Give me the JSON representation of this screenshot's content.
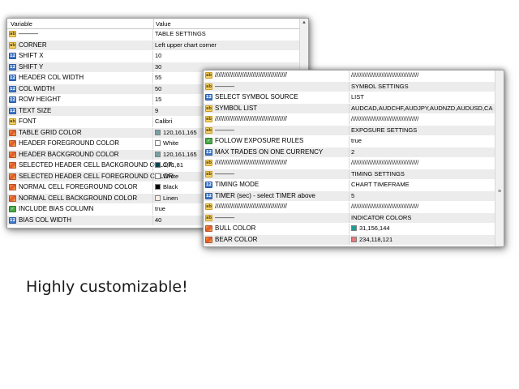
{
  "panel1": {
    "header": {
      "col_variable": "Variable",
      "col_value": "Value"
    },
    "rows": [
      {
        "icon": "abc",
        "name": "———",
        "value": "TABLE SETTINGS"
      },
      {
        "icon": "abc",
        "name": "CORNER",
        "value": "Left upper chart corner"
      },
      {
        "icon": "num",
        "name": "SHIFT X",
        "value": "10"
      },
      {
        "icon": "num",
        "name": "SHIFT Y",
        "value": "30"
      },
      {
        "icon": "num",
        "name": "HEADER COL WIDTH",
        "value": "55"
      },
      {
        "icon": "num",
        "name": "COL WIDTH",
        "value": "50"
      },
      {
        "icon": "num",
        "name": "ROW HEIGHT",
        "value": "15"
      },
      {
        "icon": "num",
        "name": "TEXT SIZE",
        "value": "9"
      },
      {
        "icon": "abc",
        "name": "FONT",
        "value": "Calibri"
      },
      {
        "icon": "col",
        "name": "TABLE GRID COLOR",
        "value": "120,161,165",
        "swatch": "#78a1a5"
      },
      {
        "icon": "col",
        "name": "HEADER FOREGROUND COLOR",
        "value": "White",
        "swatch": "#ffffff"
      },
      {
        "icon": "col",
        "name": "HEADER BACKGROUND COLOR",
        "value": "120,161,165",
        "swatch": "#78a1a5"
      },
      {
        "icon": "col",
        "name": "SELECTED HEADER CELL BACKGROUND COLOR",
        "value": "0,71,81",
        "swatch": "#004751"
      },
      {
        "icon": "col",
        "name": "SELECTED HEADER CELL FOREGROUND COLOR",
        "value": "White",
        "swatch": "#ffffff"
      },
      {
        "icon": "col",
        "name": "NORMAL CELL FOREGROUND COLOR",
        "value": "Black",
        "swatch": "#000000"
      },
      {
        "icon": "col",
        "name": "NORMAL CELL BACKGROUND COLOR",
        "value": "Linen",
        "swatch": "#faf0e6"
      },
      {
        "icon": "bool",
        "name": "INCLUDE BIAS COLUMN",
        "value": "true"
      },
      {
        "icon": "num",
        "name": "BIAS  COL WIDTH",
        "value": "40"
      }
    ]
  },
  "panel2": {
    "rows": [
      {
        "icon": "abc",
        "name": "////////////////////////////////////////",
        "value": "////////////////////////////////////////"
      },
      {
        "icon": "abc",
        "name": "———",
        "value": "SYMBOL SETTINGS"
      },
      {
        "icon": "num",
        "name": "SELECT SYMBOL SOURCE",
        "value": "LIST"
      },
      {
        "icon": "abc",
        "name": "SYMBOL LIST",
        "value": "AUDCAD,AUDCHF,AUDJPY,AUDNZD,AUDUSD,CADC..."
      },
      {
        "icon": "abc",
        "name": "////////////////////////////////////////",
        "value": "////////////////////////////////////////"
      },
      {
        "icon": "abc",
        "name": "———",
        "value": "EXPOSURE SETTINGS"
      },
      {
        "icon": "bool",
        "name": "FOLLOW EXPOSURE RULES",
        "value": "true"
      },
      {
        "icon": "num",
        "name": "MAX TRADES ON ONE CURRENCY",
        "value": "2"
      },
      {
        "icon": "abc",
        "name": "////////////////////////////////////////",
        "value": "////////////////////////////////////////"
      },
      {
        "icon": "abc",
        "name": "———",
        "value": "TIMING SETTINGS"
      },
      {
        "icon": "num",
        "name": "TIMING MODE",
        "value": "CHART TIMEFRAME"
      },
      {
        "icon": "num",
        "name": "TIMER (sec) - select TIMER above",
        "value": "5"
      },
      {
        "icon": "abc",
        "name": "////////////////////////////////////////",
        "value": "////////////////////////////////////////"
      },
      {
        "icon": "abc",
        "name": "———",
        "value": "INDICATOR COLORS"
      },
      {
        "icon": "col",
        "name": "BULL COLOR",
        "value": "31,156,144",
        "swatch": "#1f9c90"
      },
      {
        "icon": "col",
        "name": "BEAR COLOR",
        "value": "234,118,121",
        "swatch": "#ea7679"
      }
    ]
  },
  "caption": "Highly customizable!"
}
